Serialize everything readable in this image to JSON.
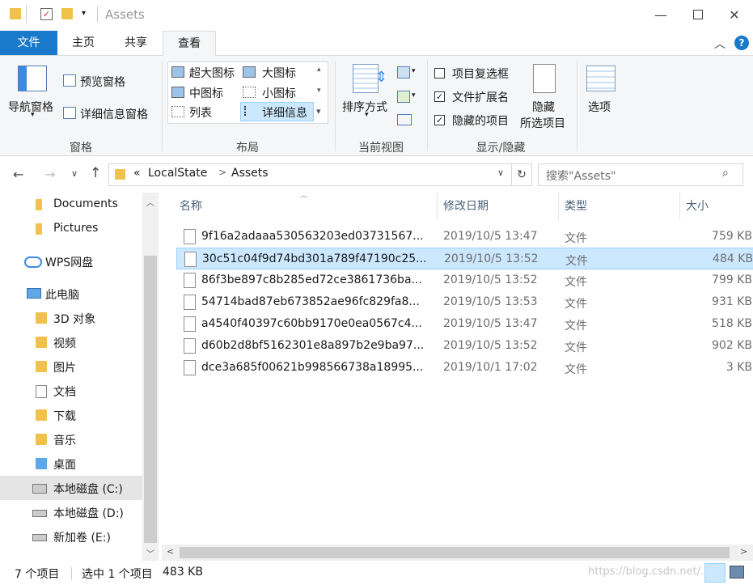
{
  "window": {
    "title": "Assets"
  },
  "tabs": {
    "file": "文件",
    "home": "主页",
    "share": "共享",
    "view": "查看"
  },
  "ribbon": {
    "pane": {
      "nav_pane": "导航窗格",
      "preview_pane": "预览窗格",
      "details_pane": "详细信息窗格",
      "label": "窗格"
    },
    "layout": {
      "xl_icons": "超大图标",
      "large_icons": "大图标",
      "medium_icons": "中图标",
      "small_icons": "小图标",
      "list": "列表",
      "details": "详细信息",
      "label": "布局"
    },
    "current_view": {
      "sort_by": "排序方式",
      "label": "当前视图"
    },
    "show_hide": {
      "item_checkboxes": "项目复选框",
      "file_extensions": "文件扩展名",
      "hidden_items": "隐藏的项目",
      "hide_selected_1": "隐藏",
      "hide_selected_2": "所选项目",
      "label": "显示/隐藏"
    },
    "options": "选项"
  },
  "address": {
    "overflow": "«",
    "crumb1": "LocalState",
    "sep": ">",
    "crumb2": "Assets"
  },
  "search": {
    "placeholder": "搜索\"Assets\""
  },
  "nav": {
    "items": [
      {
        "label": "Documents"
      },
      {
        "label": "Pictures"
      },
      {
        "label": "WPS网盘"
      },
      {
        "label": "此电脑"
      },
      {
        "label": "3D 对象"
      },
      {
        "label": "视频"
      },
      {
        "label": "图片"
      },
      {
        "label": "文档"
      },
      {
        "label": "下载"
      },
      {
        "label": "音乐"
      },
      {
        "label": "桌面"
      },
      {
        "label": "本地磁盘 (C:)"
      },
      {
        "label": "本地磁盘 (D:)"
      },
      {
        "label": "新加卷 (E:)"
      }
    ]
  },
  "columns": {
    "name": "名称",
    "modified": "修改日期",
    "type": "类型",
    "size": "大小"
  },
  "files": [
    {
      "name": "9f16a2adaaa530563203ed03731567...",
      "modified": "2019/10/5 13:47",
      "type": "文件",
      "size": "759 KB"
    },
    {
      "name": "30c51c04f9d74bd301a789f47190c25...",
      "modified": "2019/10/5 13:52",
      "type": "文件",
      "size": "484 KB"
    },
    {
      "name": "86f3be897c8b285ed72ce3861736ba...",
      "modified": "2019/10/5 13:52",
      "type": "文件",
      "size": "799 KB"
    },
    {
      "name": "54714bad87eb673852ae96fc829fa8...",
      "modified": "2019/10/5 13:53",
      "type": "文件",
      "size": "931 KB"
    },
    {
      "name": "a4540f40397c60bb9170e0ea0567c4...",
      "modified": "2019/10/5 13:47",
      "type": "文件",
      "size": "518 KB"
    },
    {
      "name": "d60b2d8bf5162301e8a897b2e9ba97...",
      "modified": "2019/10/5 13:52",
      "type": "文件",
      "size": "902 KB"
    },
    {
      "name": "dce3a685f00621b998566738a18995...",
      "modified": "2019/10/1 17:02",
      "type": "文件",
      "size": "3 KB"
    }
  ],
  "status": {
    "count": "7 个项目",
    "selected": "选中 1 个项目",
    "size": "483 KB"
  },
  "watermark": "https://blog.csdn.net/...",
  "colors": {
    "accent": "#1979ca",
    "selection": "#cce8ff",
    "selection_border": "#99d1ff"
  }
}
